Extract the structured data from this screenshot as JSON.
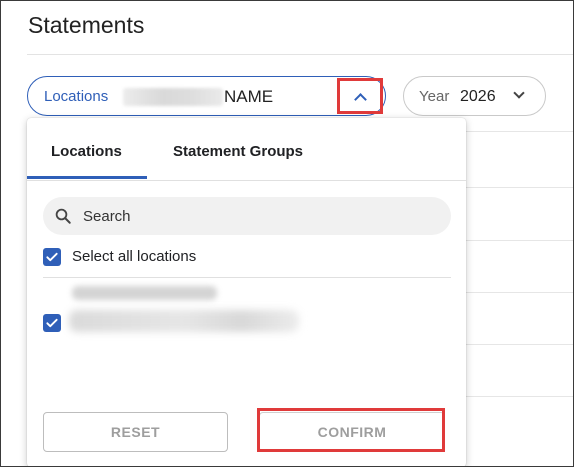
{
  "page": {
    "title": "Statements"
  },
  "filters": {
    "locations": {
      "label": "Locations",
      "value": "NAME",
      "chevron": "chevron-up-icon"
    },
    "year": {
      "label": "Year",
      "value": "2026",
      "chevron": "chevron-down-icon"
    }
  },
  "dropdown": {
    "tabs": [
      {
        "label": "Locations",
        "active": true
      },
      {
        "label": "Statement Groups",
        "active": false
      }
    ],
    "search": {
      "placeholder": "Search",
      "icon": "search-icon"
    },
    "select_all": {
      "label": "Select all locations",
      "checked": true
    },
    "items": [
      {
        "checked": true
      }
    ],
    "buttons": {
      "reset": "RESET",
      "confirm": "CONFIRM"
    }
  },
  "colors": {
    "accent": "#2f5fb8",
    "highlight": "#e03a3a",
    "disabled_text": "#9e9e9e"
  }
}
